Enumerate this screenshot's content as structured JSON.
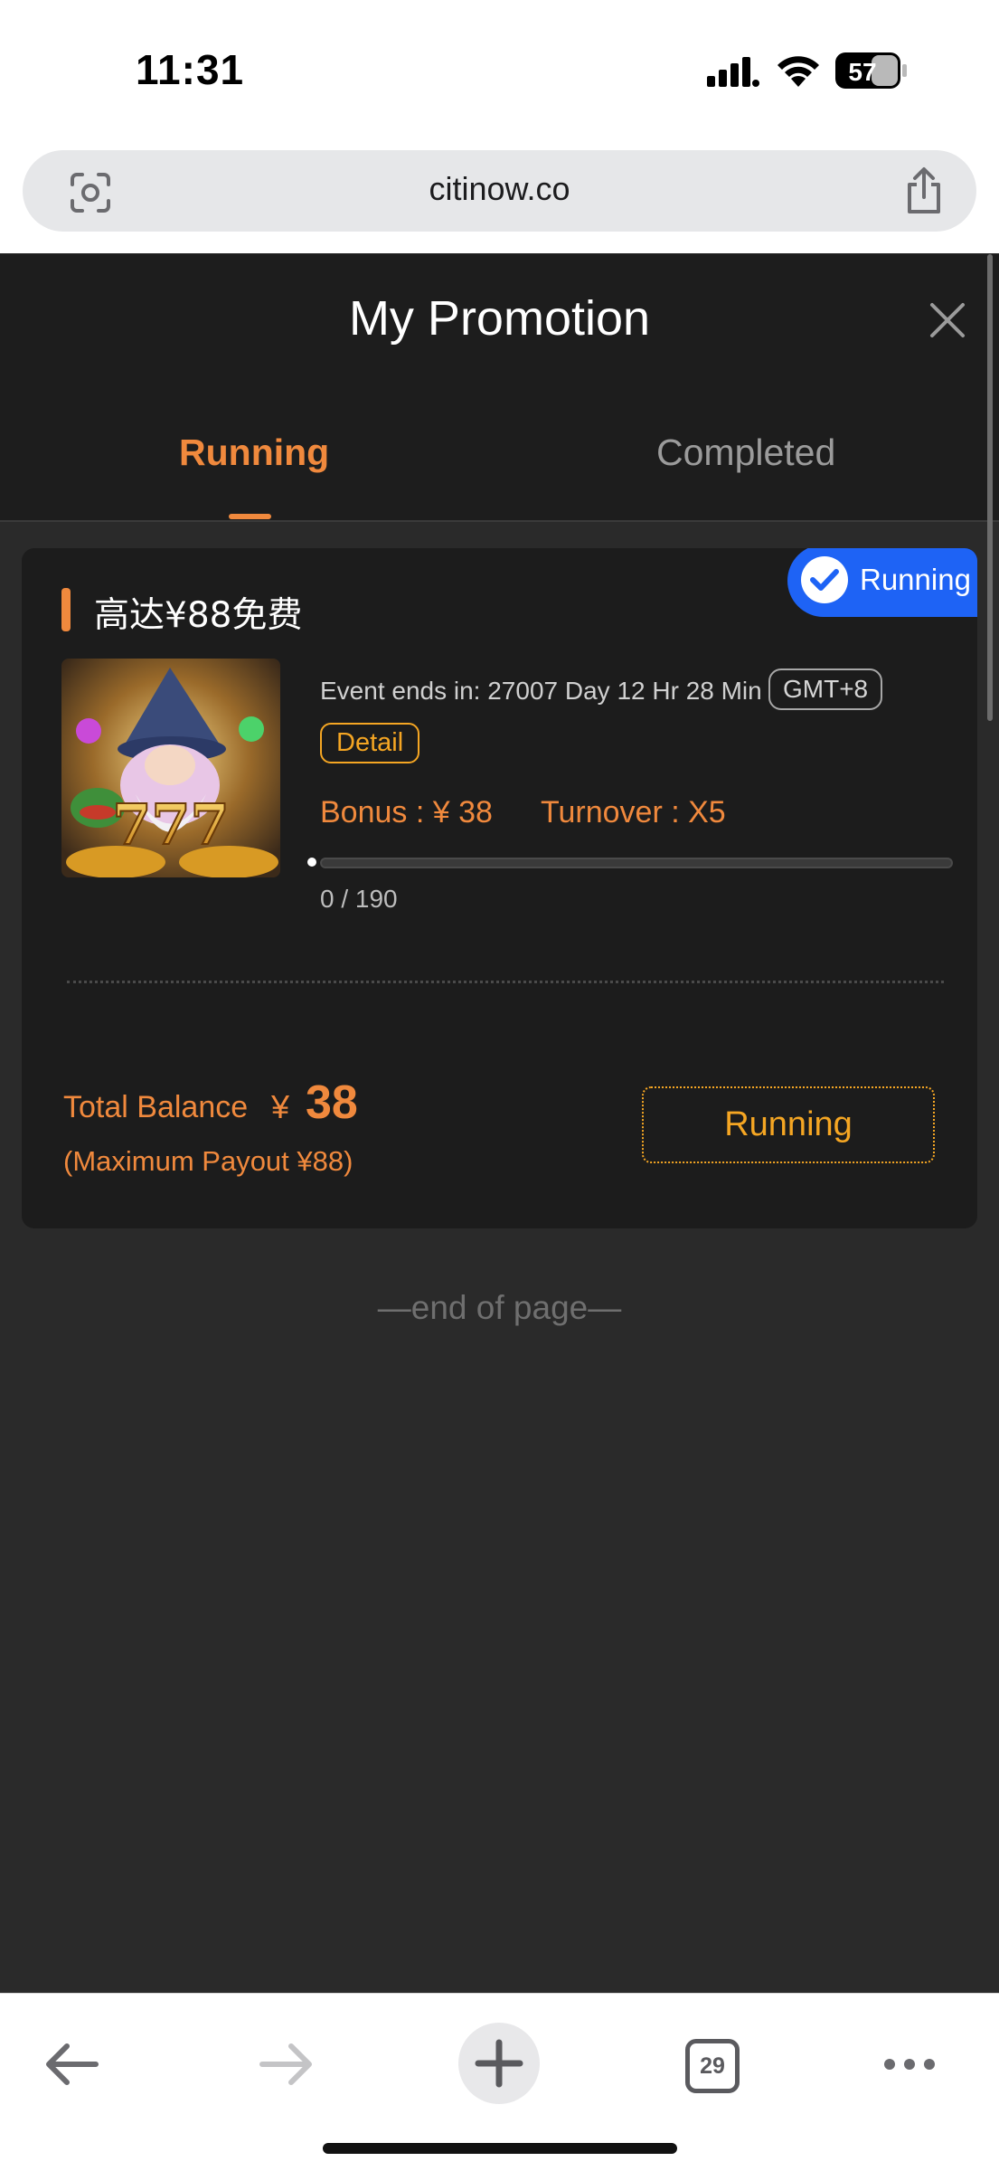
{
  "status_bar": {
    "time": "11:31",
    "battery": "57"
  },
  "browser": {
    "url": "citinow.co",
    "tab_count": "29"
  },
  "modal": {
    "title": "My Promotion",
    "tabs": [
      {
        "label": "Running",
        "active": true
      },
      {
        "label": "Completed",
        "active": false
      }
    ]
  },
  "promotion": {
    "status_badge": "Running",
    "title": "高达¥88免费",
    "event_ends": "Event ends in: 27007 Day 12 Hr 28 Min",
    "timezone": "GMT+8",
    "detail_label": "Detail",
    "bonus": "Bonus : ¥ 38",
    "turnover": "Turnover : X5",
    "progress_text": "0 / 190",
    "progress_fraction": 0,
    "total_balance_label": "Total Balance",
    "total_currency": "¥",
    "total_amount": "38",
    "max_payout": "(Maximum Payout ¥88)",
    "action_label": "Running"
  },
  "footer": {
    "end_text": "—end of page—"
  },
  "colors": {
    "accent": "#f0893d",
    "gold": "#f5a623",
    "badge_blue": "#1e63f5",
    "modal_bg": "#2a2a2a"
  }
}
